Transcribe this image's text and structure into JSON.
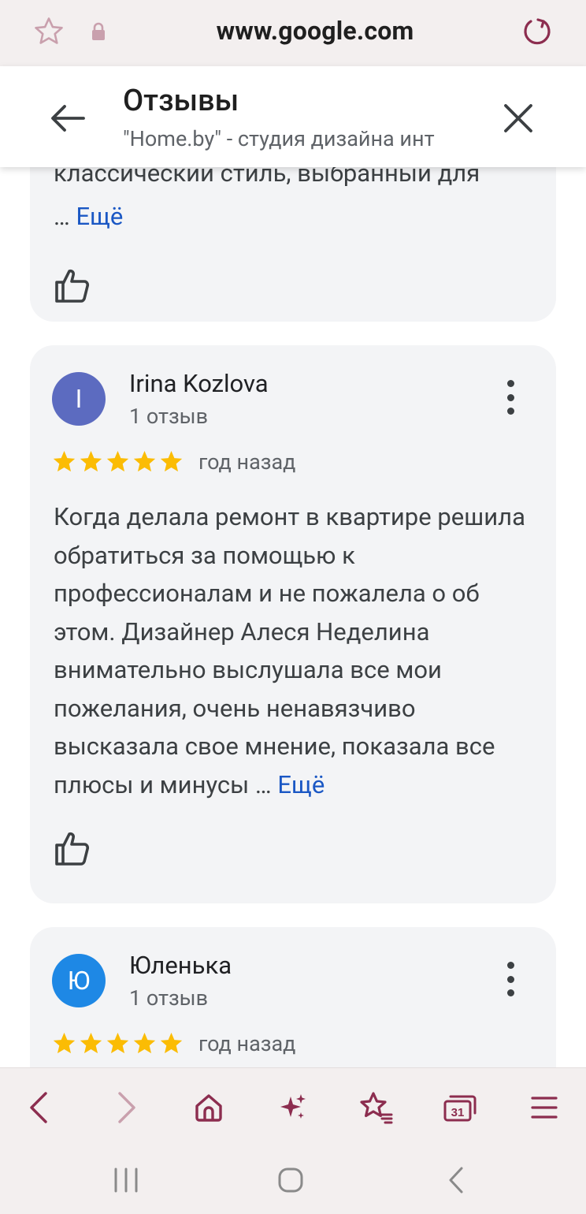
{
  "browser": {
    "url": "www.google.com"
  },
  "panel": {
    "title": "Отзывы",
    "subtitle": "\"Home.by\" - студия дизайна инт"
  },
  "reviews": [
    {
      "partial_text": "классический стиль, выбранный для",
      "ellipsis": "…",
      "more": "Ещё"
    },
    {
      "avatar_letter": "I",
      "avatar_color": "#5c6bc0",
      "name": "Irina Kozlova",
      "review_count": "1 отзыв",
      "rating": 5,
      "date": "год назад",
      "text": "Когда делала ремонт в квартире решила обратиться за помощью к профессионалам и не пожалела о об этом. Дизайнер Алеся Неделина внимательно выслушала все мои пожелания, очень ненавязчиво высказала свое мнение, показала все плюсы и минусы",
      "ellipsis": "…",
      "more": "Ещё"
    },
    {
      "avatar_letter": "Ю",
      "avatar_color": "#1e88e5",
      "name": "Юленька",
      "review_count": "1 отзыв",
      "rating": 5,
      "date": "год назад"
    }
  ],
  "colors": {
    "accent": "#8c2d4f",
    "star": "#fbbc04",
    "link": "#1a57c4"
  }
}
